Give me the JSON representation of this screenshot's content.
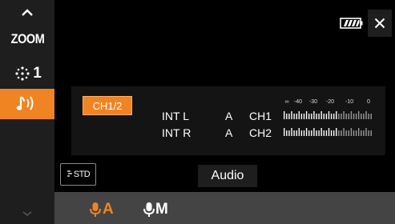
{
  "sidebar": {
    "scroll_up_icon": "chevron-up-icon",
    "zoom_label": "ZOOM",
    "effect_label": "1",
    "effect_icon": "sparkle-icon",
    "audio_icon": "audio-note-icon",
    "scroll_down_icon": "chevron-down-icon",
    "accent": "#f08423"
  },
  "header": {
    "battery_icon": "battery-full-icon",
    "close_icon": "close-icon"
  },
  "panel": {
    "ch_button_label": "CH1/2",
    "rows": [
      {
        "input": "INT L",
        "mode": "A",
        "channel": "CH1"
      },
      {
        "input": "INT R",
        "mode": "A",
        "channel": "CH2"
      }
    ],
    "scale_labels": [
      "∞",
      "-40",
      "-30",
      "-20",
      "-10",
      "0"
    ]
  },
  "footer": {
    "std_label": "STD",
    "std_icon": "wind-cut-icon",
    "title": "Audio",
    "options": [
      {
        "label": "A",
        "icon": "mic-icon",
        "selected": true
      },
      {
        "label": "M",
        "icon": "mic-icon",
        "selected": false
      }
    ]
  }
}
